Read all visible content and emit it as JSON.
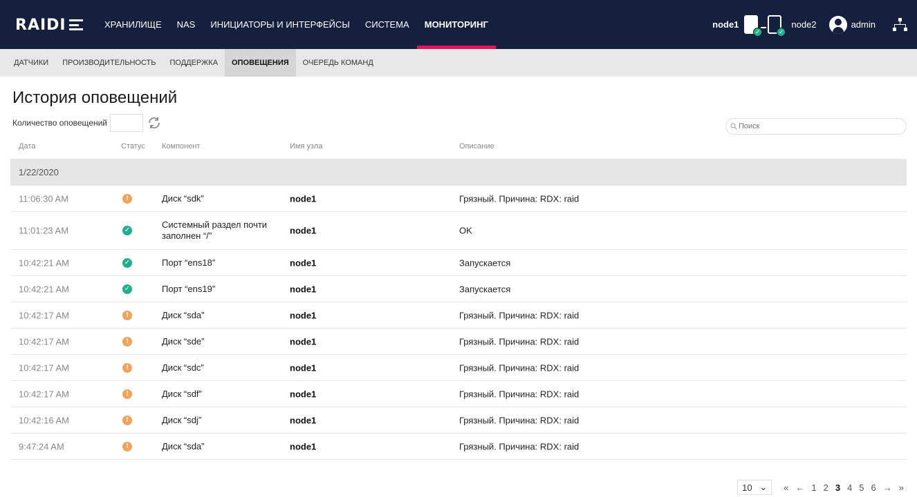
{
  "header": {
    "logo_text": "RAIDI",
    "nav": [
      "ХРАНИЛИЩЕ",
      "NAS",
      "ИНИЦИАТОРЫ И ИНТЕРФЕЙСЫ",
      "СИСТЕМА",
      "МОНИТОРИНГ"
    ],
    "active_nav": "МОНИТОРИНГ",
    "node1": "node1",
    "node2": "node2",
    "user": "admin",
    "accent_color": "#e5115c",
    "bar_color": "#14203d"
  },
  "subnav": {
    "items": [
      "ДАТЧИКИ",
      "ПРОИЗВОДИТЕЛЬНОСТЬ",
      "ПОДДЕРЖКА",
      "ОПОВЕЩЕНИЯ",
      "ОЧЕРЕДЬ КОМАНД"
    ],
    "active": "ОПОВЕЩЕНИЯ"
  },
  "page": {
    "title": "История оповещений",
    "count_label": "Количество оповещений",
    "count_value": "",
    "search_placeholder": "Поиск"
  },
  "table": {
    "columns": {
      "date": "Дата",
      "status": "Статус",
      "component": "Компонент",
      "node": "Имя узла",
      "description": "Описание"
    },
    "group_date": "1/22/2020",
    "rows": [
      {
        "time": "11:06:30 AM",
        "status": "warning",
        "component": "Диск “sdk”",
        "node": "node1",
        "description": "Грязный. Причина: RDX: raid"
      },
      {
        "time": "11:01:23 AM",
        "status": "ok",
        "component": "Системный раздел почти заполнен “/”",
        "node": "node1",
        "description": "OK"
      },
      {
        "time": "10:42:21 AM",
        "status": "ok",
        "component": "Порт “ens18”",
        "node": "node1",
        "description": "Запускается"
      },
      {
        "time": "10:42:21 AM",
        "status": "ok",
        "component": "Порт “ens19”",
        "node": "node1",
        "description": "Запускается"
      },
      {
        "time": "10:42:17 AM",
        "status": "warning",
        "component": "Диск “sda”",
        "node": "node1",
        "description": "Грязный. Причина: RDX: raid"
      },
      {
        "time": "10:42:17 AM",
        "status": "warning",
        "component": "Диск “sde”",
        "node": "node1",
        "description": "Грязный. Причина: RDX: raid"
      },
      {
        "time": "10:42:17 AM",
        "status": "warning",
        "component": "Диск “sdc”",
        "node": "node1",
        "description": "Грязный. Причина: RDX: raid"
      },
      {
        "time": "10:42:17 AM",
        "status": "warning",
        "component": "Диск “sdf”",
        "node": "node1",
        "description": "Грязный. Причина: RDX: raid"
      },
      {
        "time": "10:42:16 AM",
        "status": "warning",
        "component": "Диск “sdj”",
        "node": "node1",
        "description": "Грязный. Причина: RDX: raid"
      },
      {
        "time": "9:47:24 AM",
        "status": "warning",
        "component": "Диск “sda”",
        "node": "node1",
        "description": "Грязный. Причина: RDX: raid"
      }
    ]
  },
  "pagination": {
    "page_size": "10",
    "first": "«",
    "prev": "←",
    "pages": [
      "1",
      "2",
      "3",
      "4",
      "5",
      "6"
    ],
    "current": "3",
    "next": "→",
    "last": "»"
  },
  "icons": {
    "refresh": "refresh-icon",
    "search": "search-icon",
    "user": "user-icon",
    "network": "network-icon",
    "warning": "warning-icon",
    "ok": "ok-icon"
  }
}
